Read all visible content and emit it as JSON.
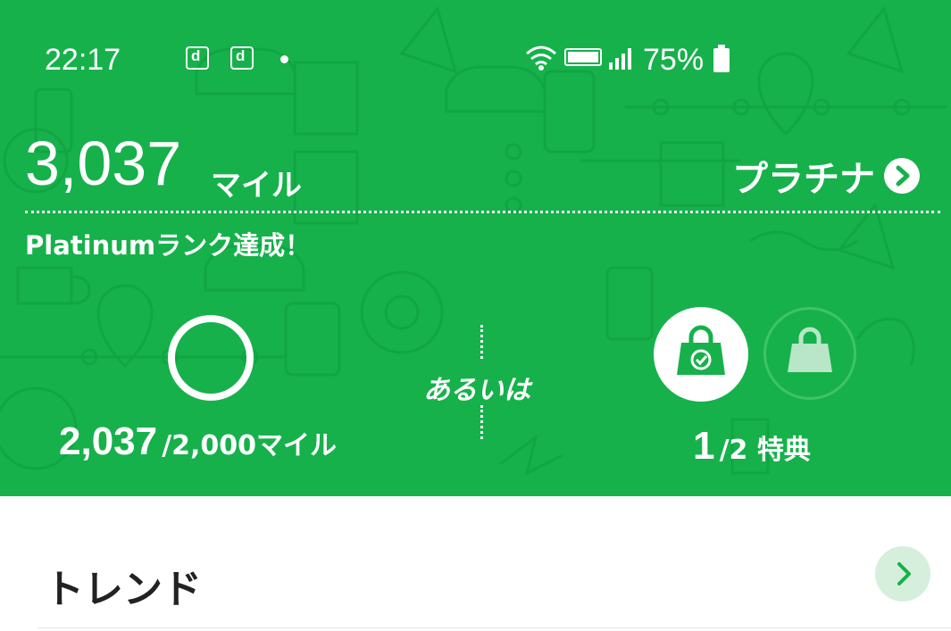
{
  "status_bar": {
    "time": "22:17",
    "notification_icons": [
      "d",
      "d"
    ],
    "battery_percent": "75%",
    "icons": [
      "wifi-icon",
      "volte-icon",
      "signal-icon",
      "battery-icon"
    ]
  },
  "summary": {
    "miles_value": "3,037",
    "miles_unit": "マイル",
    "rank_label": "プラチナ",
    "achievement": "Platinumランク達成！"
  },
  "progress": {
    "current": "2,037",
    "target_text": "/2,000マイル",
    "or_label": "あるいは",
    "benefits_current": "1",
    "benefits_text": "/2 特典",
    "ring_fraction": 1.0
  },
  "trend": {
    "title": "トレンド"
  },
  "colors": {
    "brand_green": "#16b14b",
    "light_green": "#d6efdd",
    "text_dark": "#222222"
  }
}
